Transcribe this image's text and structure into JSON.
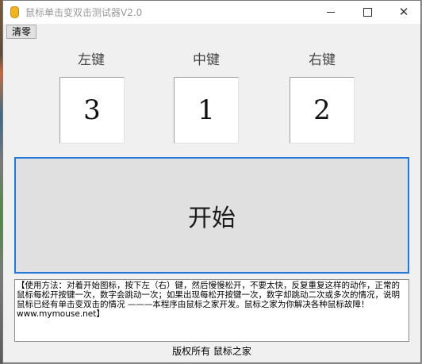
{
  "window": {
    "title": "鼠标单击变双击测试器V2.0",
    "minimize_icon": "minimize-icon",
    "maximize_icon": "maximize-icon",
    "close_icon": "close-icon",
    "close_glyph": "✕"
  },
  "toolbar": {
    "clear_label": "清零"
  },
  "counters": {
    "left_label": "左键",
    "middle_label": "中键",
    "right_label": "右键",
    "left_value": "3",
    "middle_value": "1",
    "right_value": "2"
  },
  "start_button": {
    "label": "开始"
  },
  "usage": {
    "text": "【使用方法：对着开始图标，按下左（右）键，然后慢慢松开，不要太快，反复重复这样的动作，正常的鼠标每松开按键一次，数字会跳动一次；如果出现每松开按键一次，数字却跳动二次或多次的情况，说明鼠标已经有单击变双击的情况 ———本程序由鼠标之家开发。鼠标之家为你解决各种鼠标故障！ www.mymouse.net】"
  },
  "footer": {
    "text": "版权所有 鼠标之家"
  },
  "colors": {
    "accent": "#2678d8",
    "window_bg": "#f0f0f0",
    "app_icon": "#f2b51f"
  }
}
